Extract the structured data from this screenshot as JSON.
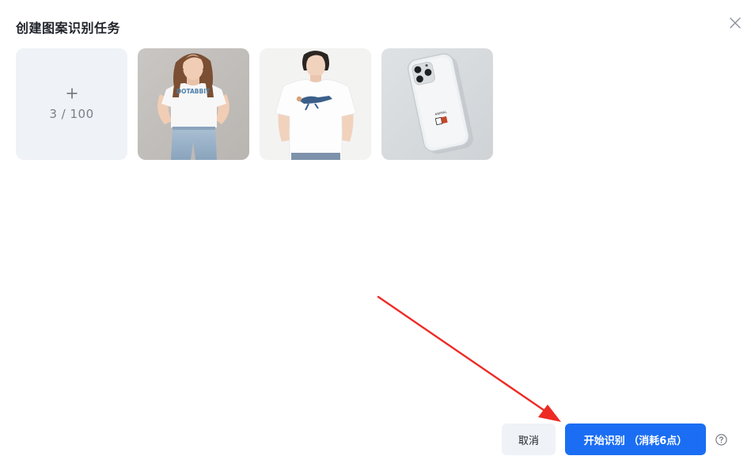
{
  "dialog": {
    "title": "创建图案识别任务",
    "close_icon": "close-icon"
  },
  "uploader": {
    "add_icon": "plus-icon",
    "count_text": "3 / 100",
    "images": [
      {
        "name": "woman-tshirt-image",
        "print_text": "DOTABBIT"
      },
      {
        "name": "man-tshirt-image",
        "print_text": ""
      },
      {
        "name": "phone-case-image",
        "print_text": ""
      }
    ]
  },
  "footer": {
    "cancel_label": "取消",
    "start_label": "开始识别 （消耗6点）",
    "help_icon": "question-circle-icon"
  },
  "colors": {
    "primary": "#1b6ef3",
    "tile_bg": "#eff2f7",
    "annotation_arrow": "#ee2a24"
  }
}
